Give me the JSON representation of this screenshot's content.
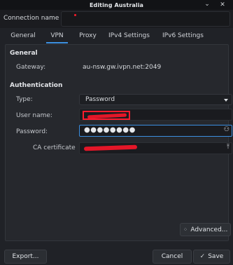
{
  "window": {
    "title": "Editing Australia",
    "minimize_icon": "chevron-down-icon",
    "close_icon": "close-icon"
  },
  "connection": {
    "label": "Connection name",
    "value": ""
  },
  "tabs": [
    {
      "label": "General",
      "active": false
    },
    {
      "label": "VPN",
      "active": true
    },
    {
      "label": "Proxy",
      "active": false
    },
    {
      "label": "IPv4 Settings",
      "active": false
    },
    {
      "label": "IPv6 Settings",
      "active": false
    }
  ],
  "general": {
    "title": "General",
    "gateway_label": "Gateway:",
    "gateway_value": "au-nsw.gw.ivpn.net:2049"
  },
  "authentication": {
    "title": "Authentication",
    "type_label": "Type:",
    "type_value": "Password",
    "username_label": "User name:",
    "password_label": "Password:",
    "password_value": "●●●●●●●●",
    "password_icon": "user-options-icon",
    "ca_label": "CA certificate",
    "ca_icon": "upload-icon"
  },
  "buttons": {
    "advanced": "Advanced...",
    "export": "Export...",
    "cancel": "Cancel",
    "save": "Save"
  },
  "colors": {
    "accent": "#3c8fe0",
    "redaction": "#ff1c2d",
    "background": "#202227"
  }
}
